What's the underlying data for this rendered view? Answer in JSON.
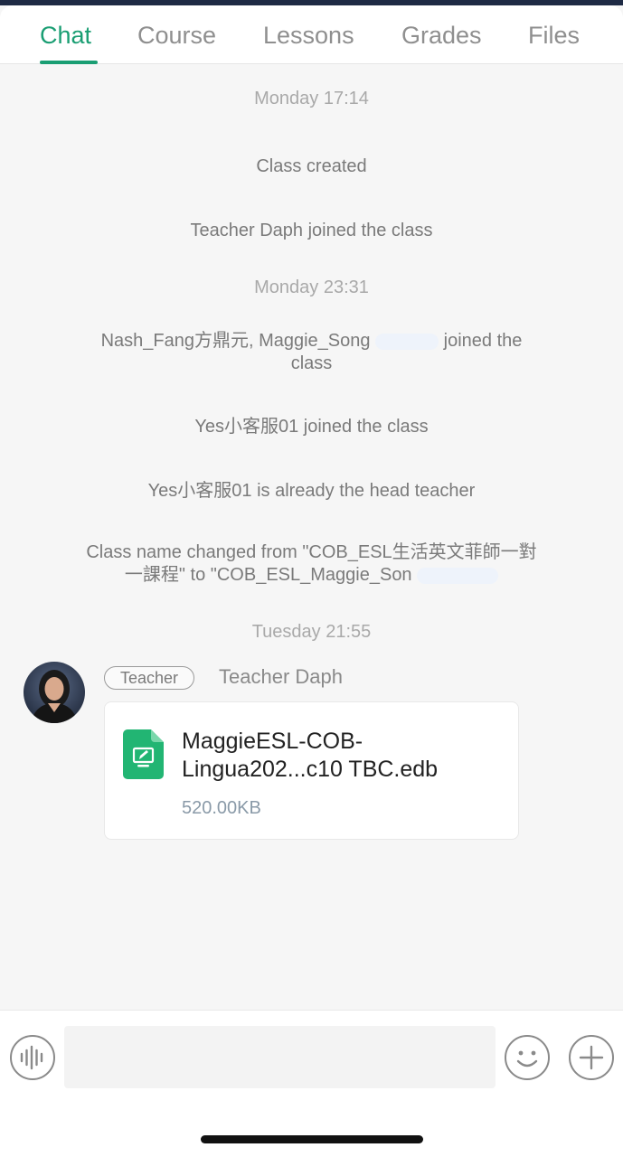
{
  "tabs": [
    {
      "label": "Chat",
      "active": true
    },
    {
      "label": "Course",
      "active": false
    },
    {
      "label": "Lessons",
      "active": false
    },
    {
      "label": "Grades",
      "active": false
    },
    {
      "label": "Files",
      "active": false
    }
  ],
  "timeline": {
    "ts1": "Monday 17:14",
    "event_class_created": "Class created",
    "event_teacher_joined": "Teacher Daph joined the class",
    "ts2": "Monday 23:31",
    "event_members_joined_line1": "Nash_Fang方鼎元, Maggie_Song",
    "event_members_joined_line1b": "joined the",
    "event_members_joined_line2": "class",
    "event_yes_joined": "Yes小客服01 joined the class",
    "event_head_teacher": "Yes小客服01 is already the head teacher",
    "event_rename_line1": "Class name changed from \"COB_ESL生活英文菲師一對",
    "event_rename_line2": "一課程\" to \"COB_ESL_Maggie_Son",
    "ts3": "Tuesday 21:55"
  },
  "message": {
    "role_badge": "Teacher",
    "sender": "Teacher Daph",
    "file_name": "MaggieESL-COB-Lingua202...c10 TBC.edb",
    "file_size": "520.00KB",
    "file_icon": "document-edit-icon"
  },
  "input_bar": {
    "placeholder": "",
    "voice_icon": "voice-wave-icon",
    "emoji_icon": "smiley-icon",
    "add_icon": "plus-icon"
  },
  "colors": {
    "accent": "#1a9e73",
    "file_icon": "#22b573"
  }
}
